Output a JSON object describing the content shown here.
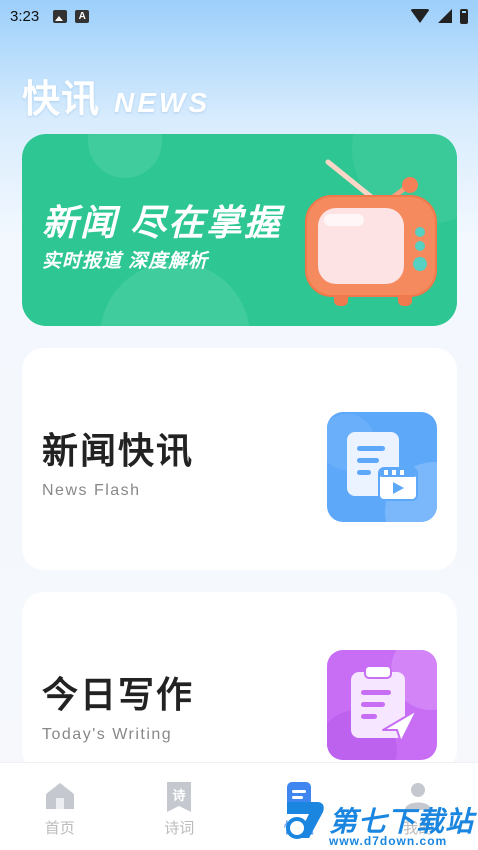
{
  "status_bar": {
    "time": "3:23",
    "icons_left": [
      "image-icon",
      "a-icon"
    ],
    "icons_right": [
      "wifi-icon",
      "signal-icon",
      "battery-icon"
    ]
  },
  "header": {
    "title_cn": "快讯",
    "title_en": "NEWS"
  },
  "banner": {
    "title": "新闻 尽在掌握",
    "subtitle": "实时报道 深度解析",
    "illustration": "tv-icon",
    "color": "#2ec793"
  },
  "cards": [
    {
      "title": "新闻快讯",
      "subtitle": "News Flash",
      "icon": "news-document-video-icon",
      "icon_color": "#5ea8fa"
    },
    {
      "title": "今日写作",
      "subtitle": "Today's Writing",
      "icon": "clipboard-send-icon",
      "icon_color": "#c86ef5"
    }
  ],
  "bottom_nav": {
    "items": [
      {
        "label": "首页",
        "icon": "home-icon",
        "active": false
      },
      {
        "label": "诗词",
        "icon": "poem-bookmark-icon",
        "active": false,
        "icon_text": "诗"
      },
      {
        "label": "快讯",
        "icon": "news-icon",
        "active": true
      },
      {
        "label": "我的",
        "icon": "user-icon",
        "active": false
      }
    ],
    "active_color": "#3f86f0"
  },
  "watermark": {
    "name": "第七下载站",
    "url": "www.d7down.com",
    "logo_text": "7",
    "color": "#1a86df"
  }
}
